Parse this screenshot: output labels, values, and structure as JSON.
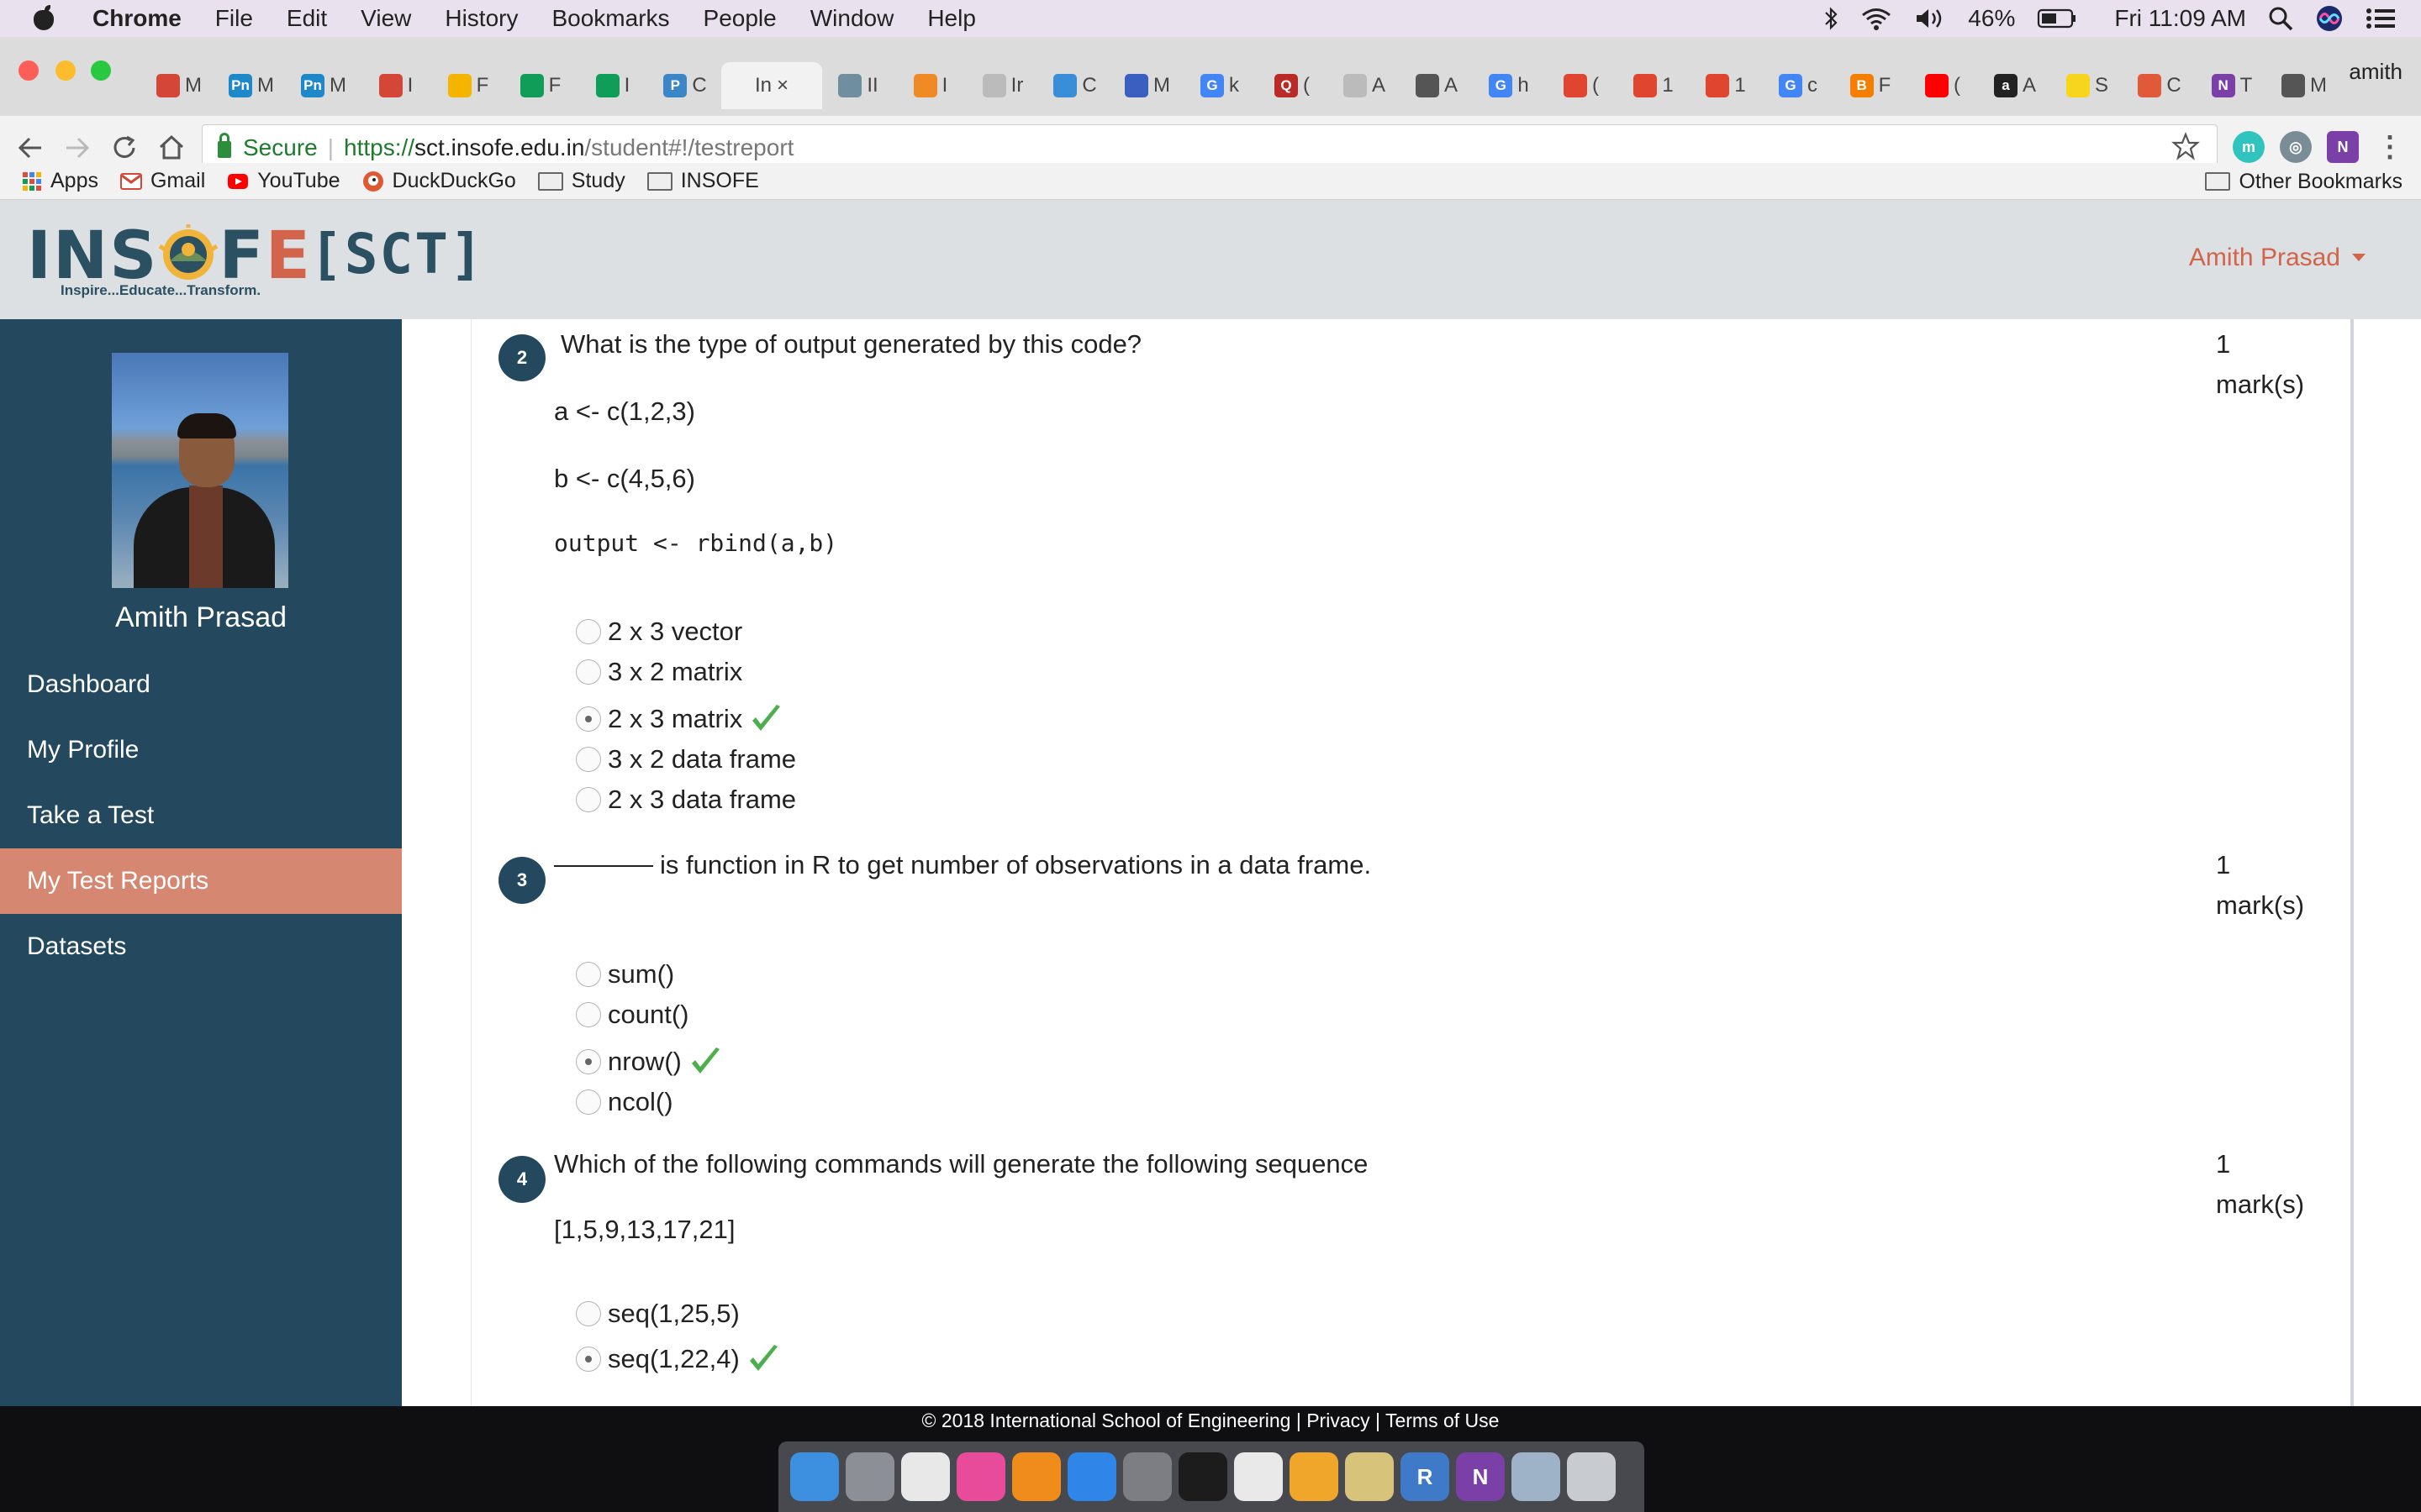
{
  "menubar": {
    "app": "Chrome",
    "items": [
      "File",
      "Edit",
      "View",
      "History",
      "Bookmarks",
      "People",
      "Window",
      "Help"
    ],
    "battery": "46%",
    "clock": "Fri 11:09 AM"
  },
  "browser": {
    "profile_name": "amith",
    "active_tab_label": "In",
    "tabs": [
      {
        "icon": "gmail-icon",
        "label": "M",
        "color": "#d44638"
      },
      {
        "icon": "pn-icon",
        "label": "M",
        "color": "#1e88c8",
        "glyph": "Pn"
      },
      {
        "icon": "pn-icon",
        "label": "M",
        "color": "#1e88c8",
        "glyph": "Pn"
      },
      {
        "icon": "gmail-icon",
        "label": "I",
        "color": "#d44638"
      },
      {
        "icon": "slides-icon",
        "label": "F",
        "color": "#f4b400"
      },
      {
        "icon": "sheets-icon",
        "label": "F",
        "color": "#0f9d58"
      },
      {
        "icon": "sheets-icon",
        "label": "I",
        "color": "#0f9d58"
      },
      {
        "icon": "p-icon",
        "label": "C",
        "color": "#3b86c6",
        "glyph": "P"
      },
      {
        "icon": "insofe-icon",
        "label": "II",
        "color": "#6f8fa0"
      },
      {
        "icon": "spark-icon",
        "label": "I",
        "color": "#f08a24"
      },
      {
        "icon": "doc-icon",
        "label": "Ir",
        "color": "#bbbbbb"
      },
      {
        "icon": "globe-icon",
        "label": "C",
        "color": "#3a8ed8"
      },
      {
        "icon": "infinity-icon",
        "label": "M",
        "color": "#3b5fc0"
      },
      {
        "icon": "google-icon",
        "label": "k",
        "color": "#4285f4",
        "glyph": "G"
      },
      {
        "icon": "quora-icon",
        "label": "(",
        "color": "#b92b27",
        "glyph": "Q"
      },
      {
        "icon": "doc-icon",
        "label": "A",
        "color": "#bbbbbb"
      },
      {
        "icon": "chart-icon",
        "label": "A",
        "color": "#555555"
      },
      {
        "icon": "google-icon",
        "label": "h",
        "color": "#4285f4",
        "glyph": "G"
      },
      {
        "icon": "pen-icon",
        "label": "(",
        "color": "#e0452f"
      },
      {
        "icon": "pen-icon",
        "label": "1",
        "color": "#e0452f"
      },
      {
        "icon": "pen-icon",
        "label": "1",
        "color": "#e0452f"
      },
      {
        "icon": "google-icon",
        "label": "c",
        "color": "#4285f4",
        "glyph": "G"
      },
      {
        "icon": "blogger-icon",
        "label": "F",
        "color": "#f57d00",
        "glyph": "B"
      },
      {
        "icon": "youtube-icon",
        "label": "(",
        "color": "#ff0000"
      },
      {
        "icon": "amazon-icon",
        "label": "A",
        "color": "#222222",
        "glyph": "a"
      },
      {
        "icon": "flipkart-icon",
        "label": "S",
        "color": "#f7d51d"
      },
      {
        "icon": "store-icon",
        "label": "C",
        "color": "#e05a3a"
      },
      {
        "icon": "onenote-icon",
        "label": "T",
        "color": "#7b3fa8",
        "glyph": "N"
      },
      {
        "icon": "loading-icon",
        "label": "M",
        "color": "#555555"
      }
    ],
    "url_scheme": "https://",
    "url_host": "sct.insofe.edu.in",
    "url_path": "/student#!/testreport",
    "secure_label": "Secure",
    "bookmarks": [
      {
        "label": "Apps",
        "icon": "apps-grid-icon"
      },
      {
        "label": "Gmail",
        "icon": "gmail-icon"
      },
      {
        "label": "YouTube",
        "icon": "youtube-icon"
      },
      {
        "label": "DuckDuckGo",
        "icon": "duckduckgo-icon"
      },
      {
        "label": "Study",
        "icon": "folder-icon"
      },
      {
        "label": "INSOFE",
        "icon": "folder-icon"
      }
    ],
    "other_bookmarks": "Other Bookmarks"
  },
  "site": {
    "logo_tagline": "Inspire...Educate...Transform.",
    "logo_sct": "[SCT]",
    "user_menu": "Amith Prasad"
  },
  "sidebar": {
    "user_name": "Amith Prasad",
    "items": [
      {
        "label": "Dashboard",
        "active": false
      },
      {
        "label": "My Profile",
        "active": false
      },
      {
        "label": "Take a Test",
        "active": false
      },
      {
        "label": "My Test Reports",
        "active": true
      },
      {
        "label": "Datasets",
        "active": false
      }
    ]
  },
  "questions": [
    {
      "number": "2",
      "text": "What is the type of output generated by this code?",
      "marks_value": "1",
      "marks_unit": "mark(s)",
      "code": [
        "a <- c(1,2,3)",
        "b <- c(4,5,6)",
        "output <- rbind(a,b)"
      ],
      "options": [
        {
          "label": "2 x 3 vector",
          "selected": false,
          "correct": false
        },
        {
          "label": "3 x 2 matrix",
          "selected": false,
          "correct": false
        },
        {
          "label": "2 x 3 matrix",
          "selected": true,
          "correct": true
        },
        {
          "label": "3 x 2 data frame",
          "selected": false,
          "correct": false
        },
        {
          "label": "2 x 3 data frame",
          "selected": false,
          "correct": false
        }
      ]
    },
    {
      "number": "3",
      "text": "is function in R to get number of observations in a data frame.",
      "marks_value": "1",
      "marks_unit": "mark(s)",
      "options": [
        {
          "label": "sum()",
          "selected": false,
          "correct": false
        },
        {
          "label": "count()",
          "selected": false,
          "correct": false
        },
        {
          "label": "nrow()",
          "selected": true,
          "correct": true
        },
        {
          "label": "ncol()",
          "selected": false,
          "correct": false
        }
      ]
    },
    {
      "number": "4",
      "text": "Which of the following commands will generate the following sequence",
      "marks_value": "1",
      "marks_unit": "mark(s)",
      "sequence": "[1,5,9,13,17,21]",
      "options": [
        {
          "label": "seq(1,25,5)",
          "selected": false,
          "correct": false
        },
        {
          "label": "seq(1,22,4)",
          "selected": true,
          "correct": true
        }
      ]
    }
  ],
  "footer": {
    "copyright": "© 2018 International School of Engineering",
    "privacy": "Privacy",
    "terms": "Terms of Use"
  },
  "dock": [
    {
      "icon": "finder-icon",
      "color": "#3d8fe0"
    },
    {
      "icon": "launchpad-icon",
      "color": "#8c8f96"
    },
    {
      "icon": "photos-icon",
      "color": "#e8e8e8"
    },
    {
      "icon": "itunes-icon",
      "color": "#e94b9b"
    },
    {
      "icon": "ibooks-icon",
      "color": "#f08c1c"
    },
    {
      "icon": "app-store-icon",
      "color": "#2f86e8"
    },
    {
      "icon": "system-preferences-icon",
      "color": "#7d7d84"
    },
    {
      "icon": "terminal-icon",
      "color": "#1c1c1c"
    },
    {
      "icon": "chrome-icon",
      "color": "#e9e9e9"
    },
    {
      "icon": "sublime-icon",
      "color": "#f0a52b"
    },
    {
      "icon": "database-icon",
      "color": "#d8c37a"
    },
    {
      "icon": "r-icon",
      "color": "#3f7ac8",
      "glyph": "R"
    },
    {
      "icon": "onenote-icon",
      "color": "#7b3fa8",
      "glyph": "N"
    },
    {
      "icon": "preview-icon",
      "color": "#9fb3c8"
    },
    {
      "icon": "trash-icon",
      "color": "#c8ccd0"
    }
  ]
}
